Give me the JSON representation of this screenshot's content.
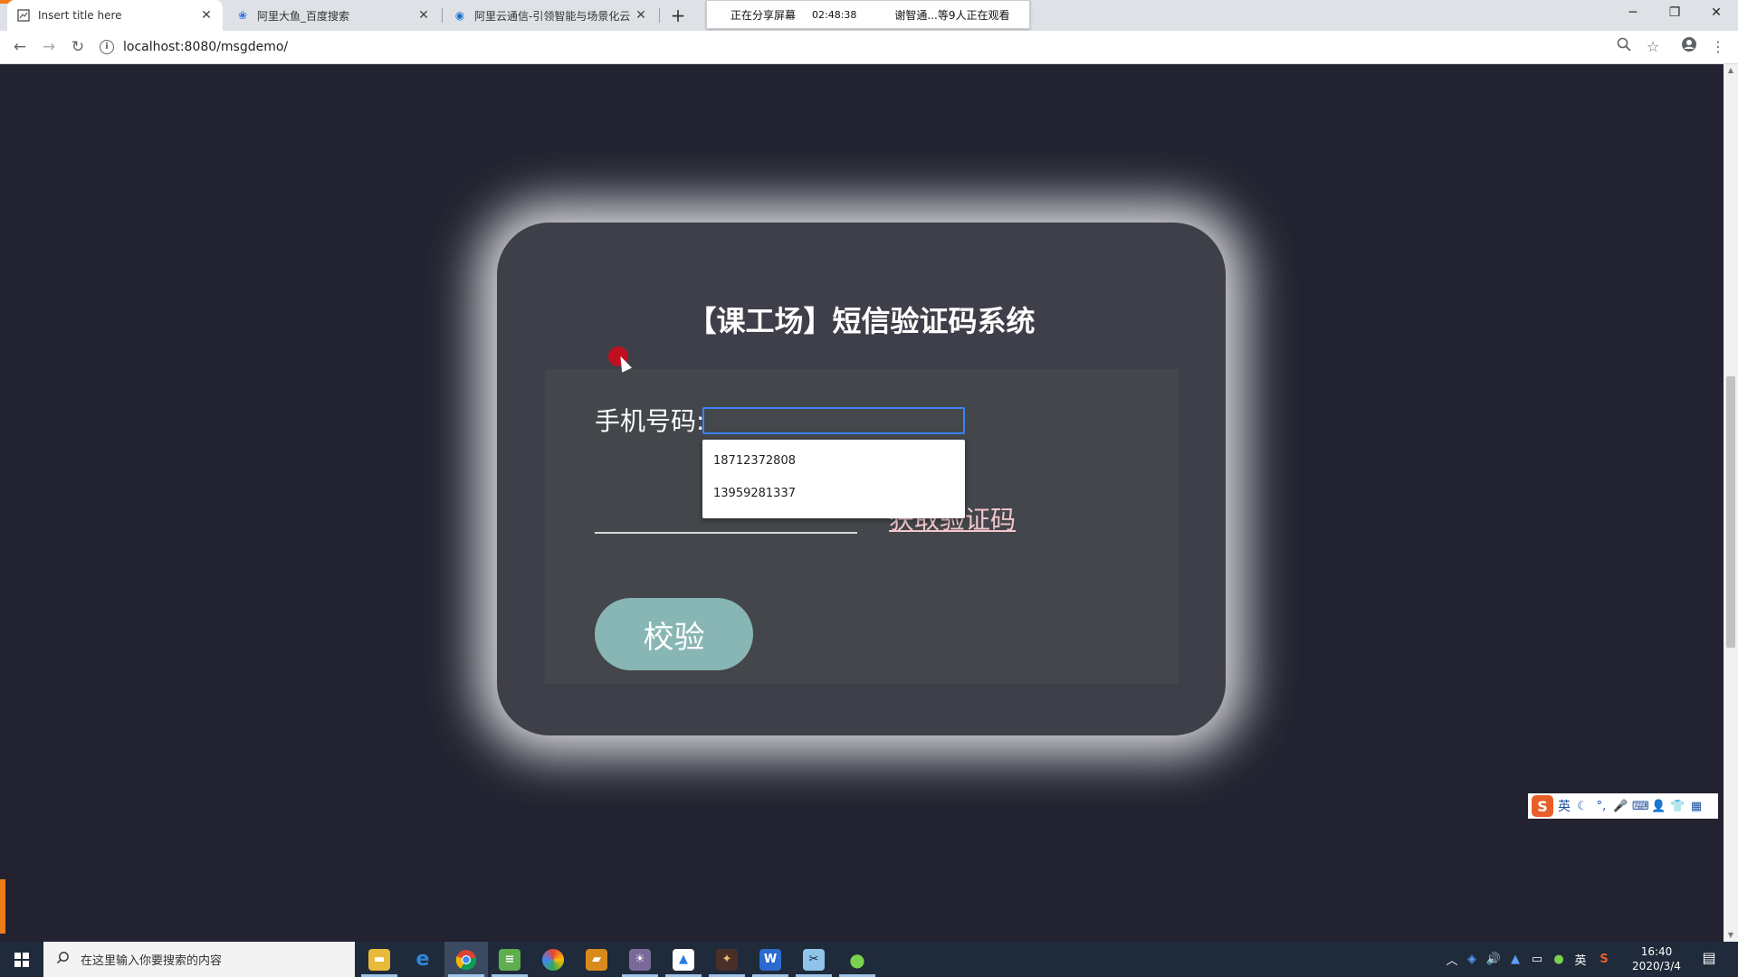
{
  "browser": {
    "tabs": [
      {
        "title": "Insert title here",
        "icon": "page-icon",
        "active": true
      },
      {
        "title": "阿里大鱼_百度搜索",
        "icon": "baidu-paw-icon",
        "active": false
      },
      {
        "title": "阿里云通信-引领智能与场景化云",
        "icon": "aliyun-icon",
        "active": false
      }
    ],
    "url": "localhost:8080/msgdemo/",
    "screen_share": {
      "status": "正在分享屏幕",
      "timer": "02:48:38",
      "viewers": "谢智通...等9人正在观看"
    }
  },
  "page": {
    "title": "【课工场】短信验证码系统",
    "phone_label": "手机号码:",
    "get_code_link": "获取验证码",
    "verify_button": "校验",
    "autocomplete": [
      "18712372808",
      "13959281337"
    ]
  },
  "ime": {
    "lang": "英"
  },
  "taskbar": {
    "search_placeholder": "在这里输入你要搜索的内容",
    "tray_lang": "英",
    "time": "16:40",
    "date": "2020/3/4"
  }
}
